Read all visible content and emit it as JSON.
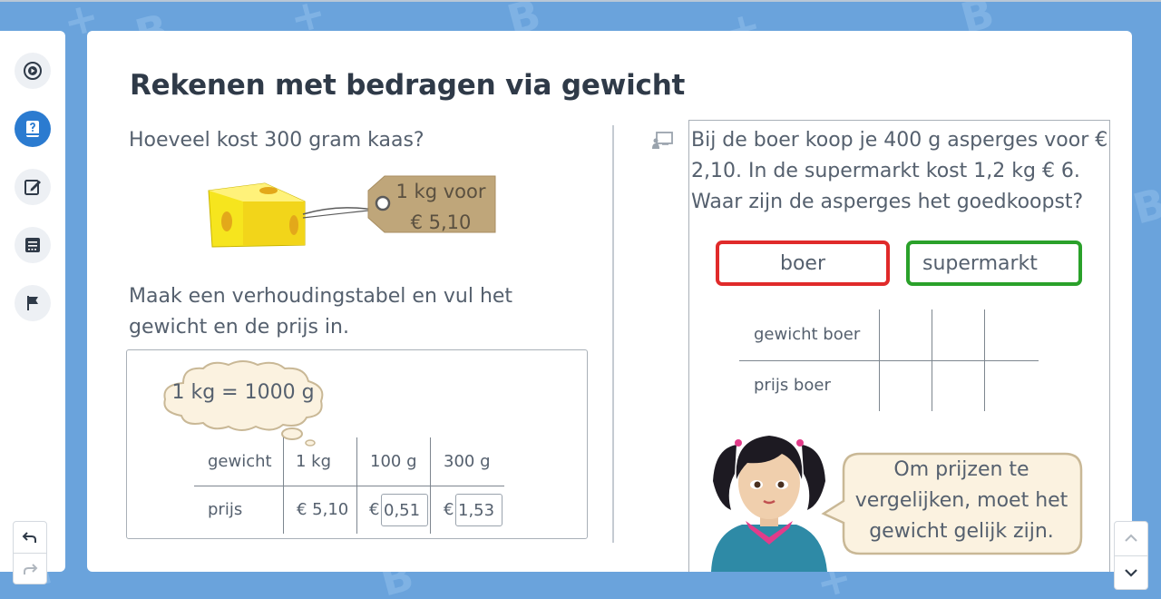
{
  "page_title": "Rekenen met bedragen via gewicht",
  "sidebar": {
    "items": [
      {
        "icon": "play-circle-icon"
      },
      {
        "icon": "lesson-book-icon",
        "active": true
      },
      {
        "icon": "edit-icon"
      },
      {
        "icon": "notes-icon"
      },
      {
        "icon": "flag-icon"
      }
    ],
    "undo_icon": "undo-icon",
    "redo_icon": "redo-icon"
  },
  "left": {
    "question": "Hoeveel kost 300 gram kaas?",
    "price_tag": {
      "line1": "1 kg voor",
      "line2": "€ 5,10"
    },
    "instruction": "Maak een verhoudingstabel en vul het gewicht en de prijs in.",
    "thought_bubble": "1 kg = 1000 g",
    "table": {
      "row_headers": [
        "gewicht",
        "prijs"
      ],
      "columns": [
        "1 kg",
        "100 g",
        "300 g"
      ],
      "prices": [
        "€ 5,10",
        "€",
        "€"
      ],
      "inputs": [
        "0,51",
        "1,53"
      ]
    }
  },
  "right": {
    "question": "Bij de boer koop je 400 g asperges voor € 2,10. In de supermarkt kost 1,2 kg € 6. Waar zijn de asperges het goedkoopst?",
    "choices": [
      "boer",
      "supermarkt"
    ],
    "choice_colors": {
      "boer": "#e02a2a",
      "supermarkt": "#2aa12a"
    },
    "table": {
      "row_headers": [
        "gewicht boer",
        "prijs boer"
      ]
    },
    "speech": "Om prijzen te vergelijken, moet het gewicht gelijk zijn."
  },
  "scroll": {
    "up_icon": "chevron-up-icon",
    "down_icon": "chevron-down-icon"
  }
}
